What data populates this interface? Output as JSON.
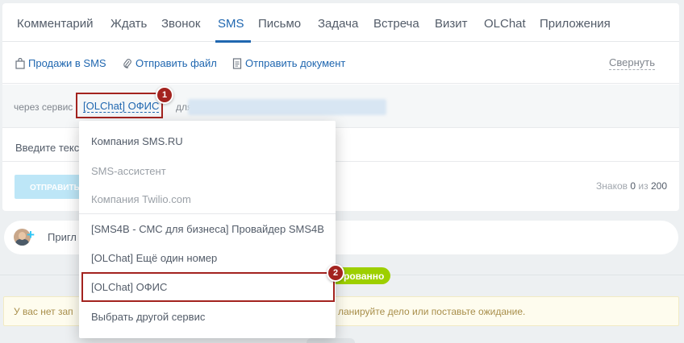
{
  "tabs": [
    {
      "label": "Комментарий",
      "active": false
    },
    {
      "label": "Ждать",
      "active": false
    },
    {
      "label": "Звонок",
      "active": false
    },
    {
      "label": "SMS",
      "active": true
    },
    {
      "label": "Письмо",
      "active": false
    },
    {
      "label": "Задача",
      "active": false
    },
    {
      "label": "Встреча",
      "active": false
    },
    {
      "label": "Визит",
      "active": false
    },
    {
      "label": "OLChat",
      "active": false
    },
    {
      "label": "Приложения",
      "active": false
    }
  ],
  "toolbar": {
    "sales_in_sms": "Продажи в SMS",
    "send_file": "Отправить файл",
    "send_document": "Отправить документ",
    "collapse": "Свернуть"
  },
  "sender": {
    "via_label": "через сервис",
    "service_name": "[OLChat] ОФИС",
    "for_label": "для"
  },
  "message": {
    "placeholder": "Введите текс"
  },
  "footer": {
    "send_button": "ОТПРАВИТЬ",
    "chars_label": "Знаков",
    "chars_count": "0",
    "chars_of": "из",
    "chars_max": "200"
  },
  "invite": {
    "text": "Пригл"
  },
  "status_badge": "рованно",
  "notice": {
    "left_text": "У вас нет зап",
    "right_text": "ланируйте дело или поставьте ожидание."
  },
  "dropdown": {
    "items": [
      {
        "label": "Компания SMS.RU",
        "enabled": true
      },
      {
        "label": "SMS-ассистент",
        "enabled": false
      },
      {
        "label": "Компания Twilio.com",
        "enabled": false
      },
      {
        "label": "[SMS4B - СМС для бизнеса] Провайдер SMS4B",
        "enabled": true
      },
      {
        "label": "[OLChat] Ещё один номер",
        "enabled": true
      },
      {
        "label": "[OLChat] ОФИС",
        "enabled": true
      },
      {
        "label": "Выбрать другой сервис",
        "enabled": true
      }
    ]
  },
  "markers": [
    "1",
    "2"
  ],
  "colors": {
    "accent": "#2067b0",
    "highlight": "#a3231f",
    "status_green": "#9dcf00"
  }
}
